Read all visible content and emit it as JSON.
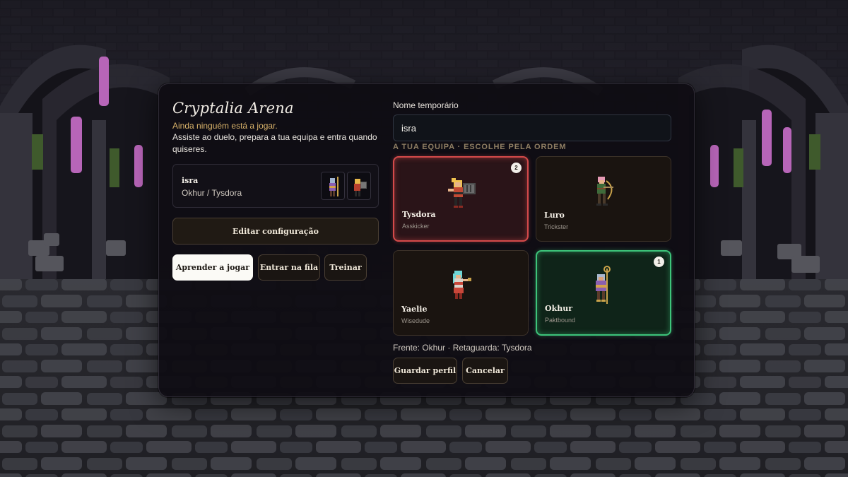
{
  "game": {
    "title": "Cryptalia Arena",
    "status": "Ainda ninguém está a jogar.",
    "description": "Assiste ao duelo, prepara a tua equipa e entra quando quiseres."
  },
  "profile": {
    "name": "isra",
    "team": "Okhur / Tysdora"
  },
  "actions": {
    "edit": "Editar configuração",
    "learn": "Aprender a jogar",
    "queue": "Entrar na fila",
    "train": "Treinar"
  },
  "form": {
    "name_label": "Nome temporário",
    "name_value": "isra",
    "team_heading": "A TUA EQUIPA · ESCOLHE PELA ORDEM",
    "formation": "Frente: Okhur · Retaguarda: Tysdora",
    "save": "Guardar perfil",
    "cancel": "Cancelar"
  },
  "characters": [
    {
      "name": "Tysdora",
      "role": "Asskicker",
      "order": "2",
      "selected": true,
      "highlight": "#d44a4a"
    },
    {
      "name": "Luro",
      "role": "Trickster",
      "order": "",
      "selected": false
    },
    {
      "name": "Yaelie",
      "role": "Wisedude",
      "order": "",
      "selected": false
    },
    {
      "name": "Okhur",
      "role": "Paktbound",
      "order": "1",
      "selected": true,
      "highlight": "#3dc47a"
    }
  ],
  "colors": {
    "accent_gold": "#d8b26a",
    "selected_red": "#d44a4a",
    "selected_green": "#3dc47a",
    "panel_bg": "#0e0c12"
  }
}
